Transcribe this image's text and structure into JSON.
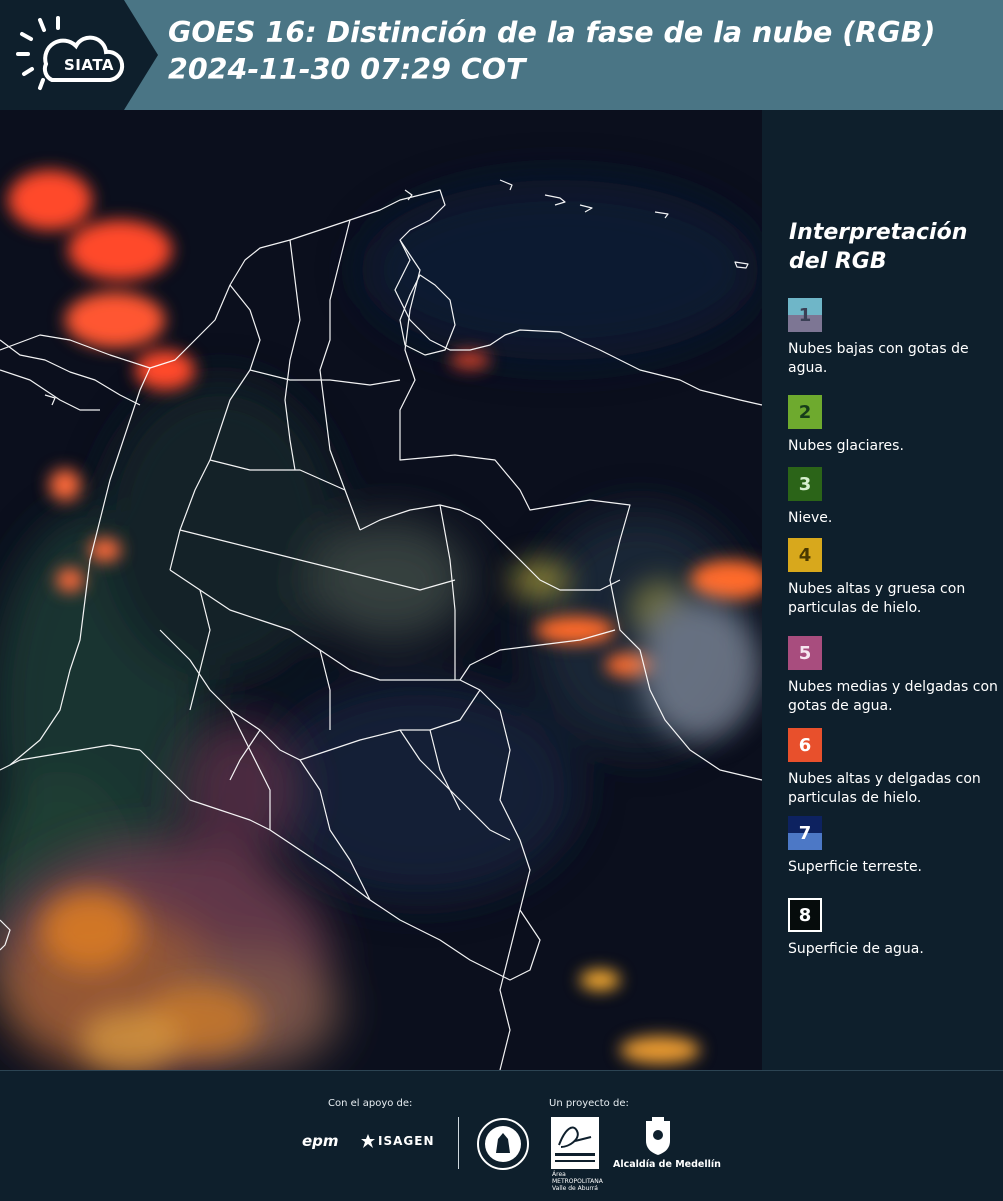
{
  "header": {
    "title": "GOES 16: Distinción de la fase de la nube (RGB)\n 2024-11-30 07:29 COT",
    "logo_text": "SIATA"
  },
  "legend": {
    "title": "Interpretación del RGB",
    "items": [
      {
        "number": "1",
        "label": "Nubes bajas con gotas de agua.",
        "color_top": "#6fb6c8",
        "color_bottom": "#7d7694",
        "text_color": "#3a3f55"
      },
      {
        "number": "2",
        "label": "Nubes glaciares.",
        "color_top": "#6eaa2e",
        "color_bottom": "#6eaa2e",
        "text_color": "#173d1a"
      },
      {
        "number": "3",
        "label": "Nieve.",
        "color_top": "#2b6418",
        "color_bottom": "#2b6418",
        "text_color": "#d8f0d0"
      },
      {
        "number": "4",
        "label": "Nubes altas y gruesa con particulas de hielo.",
        "color_top": "#d8a81c",
        "color_bottom": "#d8a81c",
        "text_color": "#4a3800"
      },
      {
        "number": "5",
        "label": "Nubes medias y delgadas con gotas de agua.",
        "color_top": "#a84d7e",
        "color_bottom": "#a84d7e",
        "text_color": "#f6e6f0"
      },
      {
        "number": "6",
        "label": "Nubes altas y delgadas con particulas de hielo.",
        "color_top": "#e8502c",
        "color_bottom": "#e8502c",
        "text_color": "#ffffff"
      },
      {
        "number": "7",
        "label": "Superficie terreste.",
        "color_top": "#0d2260",
        "color_bottom": "#4c78c6",
        "text_color": "#ffffff"
      },
      {
        "number": "8",
        "label": "Superficie de agua.",
        "color_top": "#060c0c",
        "color_bottom": "#060c0c",
        "text_color": "#ffffff",
        "border": "#ffffff"
      }
    ]
  },
  "footer": {
    "support_caption": "Con el apoyo de:",
    "project_caption": "Un proyecto de:",
    "support_logos": [
      "epm",
      "ISAGEN"
    ],
    "project_logos": [
      "Área METROPOLITANA Valle de Aburrá",
      "Alcaldía de Medellín"
    ]
  },
  "colors": {
    "header_bg": "#4a7585",
    "header_logo_bg": "#0e1f2c",
    "page_bg": "#0e1f2c",
    "map_bg": "#0b0f1d",
    "border_line": "#ffffff"
  }
}
